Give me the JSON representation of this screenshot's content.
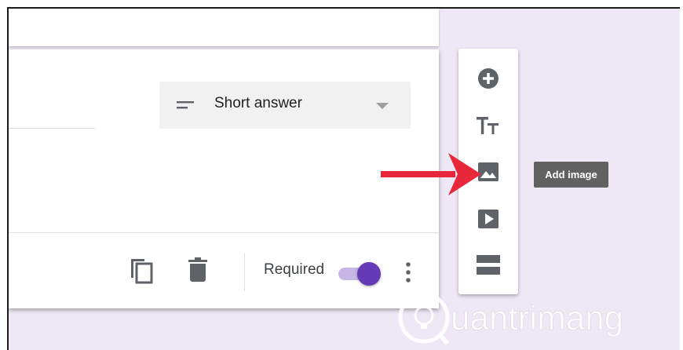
{
  "question": {
    "type_select": {
      "label": "Short answer",
      "icon": "short-text-lines-icon"
    }
  },
  "footer": {
    "required_label": "Required",
    "required_toggle_on": true,
    "icons": [
      "duplicate-icon",
      "delete-icon",
      "more-vert-icon"
    ]
  },
  "side_toolbar": {
    "items": [
      {
        "name": "add-question",
        "icon": "add-circle-icon"
      },
      {
        "name": "add-title-description",
        "icon": "title-tt-icon"
      },
      {
        "name": "add-image",
        "icon": "image-icon"
      },
      {
        "name": "add-video",
        "icon": "video-play-icon"
      },
      {
        "name": "add-section",
        "icon": "section-icon"
      }
    ]
  },
  "tooltip": {
    "text": "Add image"
  },
  "annotation": {
    "arrow_color": "#e8273b"
  },
  "watermark": {
    "text": "uantrimang"
  },
  "colors": {
    "accent": "#673ab7",
    "accent_light": "#c5b6e6",
    "background": "#ede7f6",
    "icon": "#5f6368"
  }
}
